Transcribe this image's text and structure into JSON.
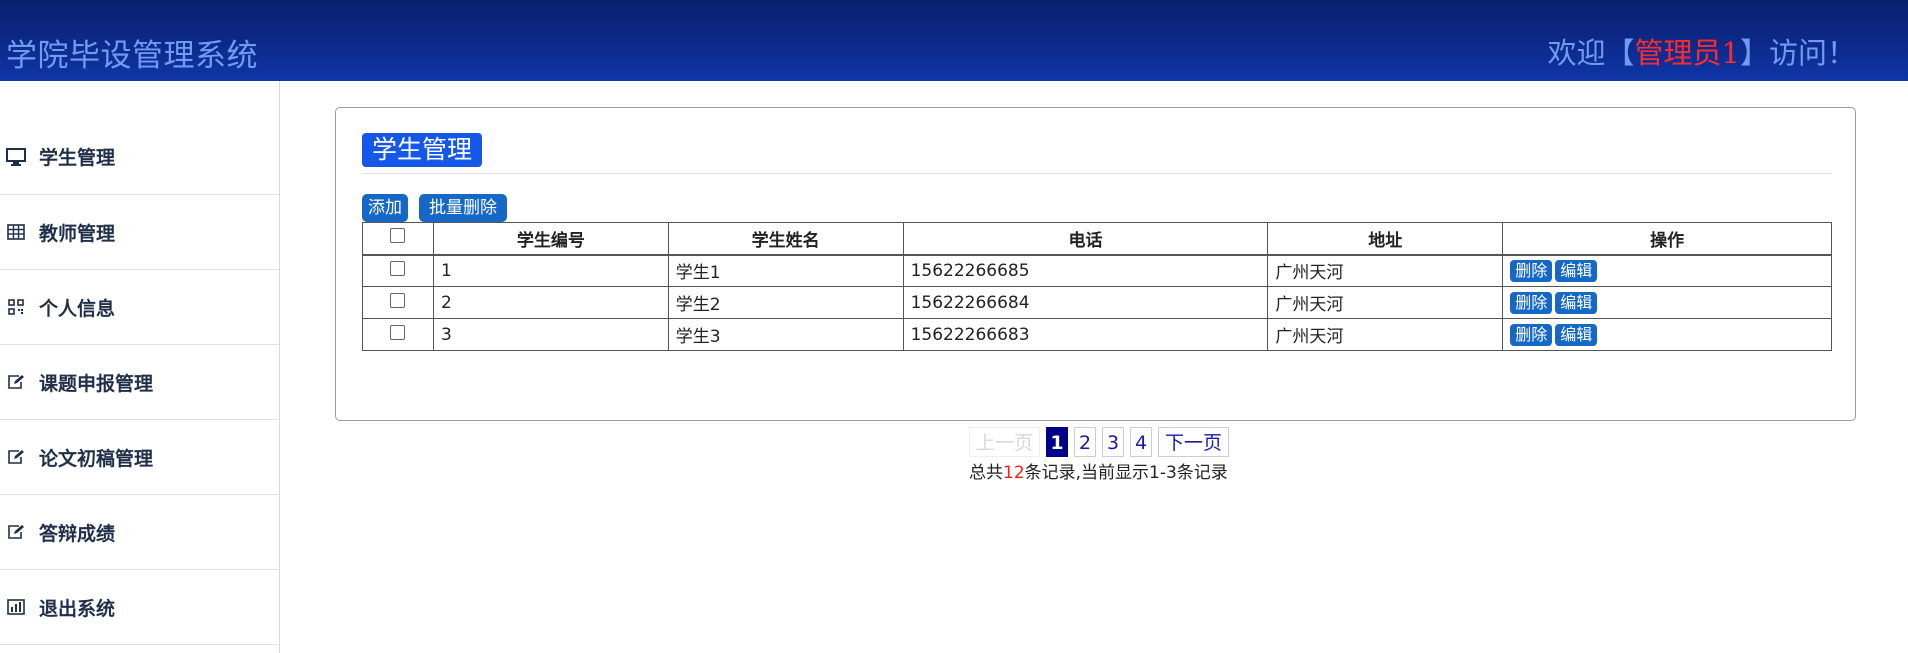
{
  "header": {
    "brand": "学院毕设管理系统",
    "welcome_prefix": "欢迎【",
    "user": "管理员1",
    "welcome_suffix": "】访问！"
  },
  "sidebar": {
    "items": [
      {
        "label": "学生管理",
        "icon": "monitor-icon"
      },
      {
        "label": "教师管理",
        "icon": "table-icon"
      },
      {
        "label": "个人信息",
        "icon": "qrcode-icon"
      },
      {
        "label": "课题申报管理",
        "icon": "edit-icon"
      },
      {
        "label": "论文初稿管理",
        "icon": "edit-icon"
      },
      {
        "label": "答辩成绩",
        "icon": "edit-icon"
      },
      {
        "label": "退出系统",
        "icon": "bar-chart-icon"
      }
    ]
  },
  "main": {
    "title": "学生管理",
    "add_label": "添加",
    "bulk_delete_label": "批量删除",
    "columns": [
      "学生编号",
      "学生姓名",
      "电话",
      "地址",
      "操作"
    ],
    "rows": [
      {
        "id": "1",
        "name": "学生1",
        "phone": "15622266685",
        "address": "广州天河"
      },
      {
        "id": "2",
        "name": "学生2",
        "phone": "15622266684",
        "address": "广州天河"
      },
      {
        "id": "3",
        "name": "学生3",
        "phone": "15622266683",
        "address": "广州天河"
      }
    ],
    "row_actions": {
      "delete": "删除",
      "edit": "编辑"
    }
  },
  "pagination": {
    "prev": "上一页",
    "pages": [
      "1",
      "2",
      "3",
      "4"
    ],
    "current": "1",
    "next": "下一页",
    "summary_prefix": "总共",
    "total": "12",
    "summary_suffix": "条记录,当前显示1-3条记录"
  },
  "colors": {
    "header": "#0d2a8a",
    "brand_text": "#6f9cf2",
    "accent": "#1557e9",
    "button": "#1668c6",
    "highlight_red": "#ff1a1a"
  }
}
